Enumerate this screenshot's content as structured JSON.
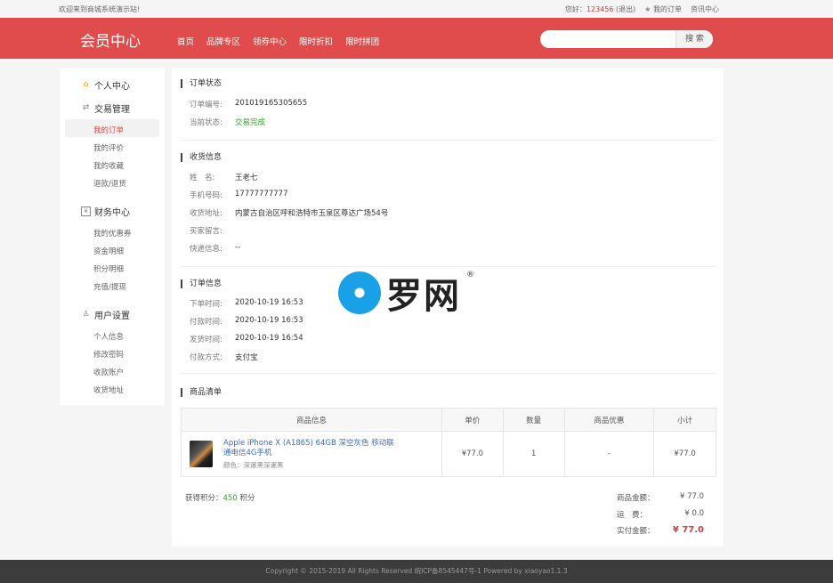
{
  "topbar": {
    "welcome": "欢迎来到商城系统演示站!",
    "greeting": "您好：",
    "user_id": "123456",
    "logout": "(退出)",
    "my_orders": "我的订单",
    "news": "资讯中心"
  },
  "header": {
    "title": "会员中心",
    "nav": [
      "首页",
      "品牌专区",
      "领券中心",
      "限时折扣",
      "限时拼团"
    ],
    "search_placeholder": "",
    "search_button": "搜 索"
  },
  "sidebar": {
    "groups": [
      {
        "label": "个人中心",
        "icon": "home-icon"
      },
      {
        "label": "交易管理",
        "icon": "exchange-icon",
        "items": [
          "我的订单",
          "我的评价",
          "我的收藏",
          "退款/退货"
        ]
      },
      {
        "label": "财务中心",
        "icon": "wallet-icon",
        "items": [
          "我的优惠券",
          "资金明细",
          "积分明细",
          "充值/提现"
        ]
      },
      {
        "label": "用户设置",
        "icon": "user-icon",
        "items": [
          "个人信息",
          "修改密码",
          "收款账户",
          "收货地址"
        ]
      }
    ],
    "active_item": "我的订单"
  },
  "order_status": {
    "title": "订单状态",
    "order_no_label": "订单编号:",
    "order_no": "201019165305655",
    "status_label": "当前状态:",
    "status": "交易完成"
  },
  "receiver": {
    "title": "收货信息",
    "name_label": "姓　名:",
    "name": "王老七",
    "phone_label": "手机号码:",
    "phone": "17777777777",
    "address_label": "收货地址:",
    "address": "内蒙古自治区呼和浩特市玉泉区尊达广场54号",
    "message_label": "买家留言:",
    "message": "",
    "express_label": "快递信息:",
    "express": "--"
  },
  "order_info": {
    "title": "订单信息",
    "order_time_label": "下单时间:",
    "order_time": "2020-10-19 16:53",
    "pay_time_label": "付款时间:",
    "pay_time": "2020-10-19 16:53",
    "ship_time_label": "发货时间:",
    "ship_time": "2020-10-19 16:54",
    "pay_method_label": "付款方式:",
    "pay_method": "支付宝"
  },
  "goods": {
    "title": "商品清单",
    "columns": [
      "商品信息",
      "单价",
      "数量",
      "商品优惠",
      "小计"
    ],
    "rows": [
      {
        "name": "Apple iPhone X (A1865) 64GB 深空灰色 移动联通电信4G手机",
        "spec": "颜色：深邃黑深邃黑",
        "price": "¥77.0",
        "qty": "1",
        "discount": "-",
        "subtotal": "¥77.0"
      }
    ]
  },
  "summary": {
    "points_label": "获得积分：",
    "points": "450",
    "points_unit": "积分",
    "goods_amount_label": "商品金额：",
    "goods_amount": "¥ 77.0",
    "shipping_label": "运　费：",
    "shipping": "¥ 0.0",
    "paid_label": "实付金额：",
    "paid": "¥ 77.0"
  },
  "watermark": {
    "text": "罗网",
    "mark": "®"
  },
  "footer": {
    "text": "Copyright © 2015-2019 All Rights Reserved 皖ICP备8545447号-1   Powered by xiaoyao1.1.3"
  },
  "colors": {
    "brand_red": "#e04b4b",
    "status_green": "#2aa52a",
    "link_blue": "#3a6bc4"
  }
}
